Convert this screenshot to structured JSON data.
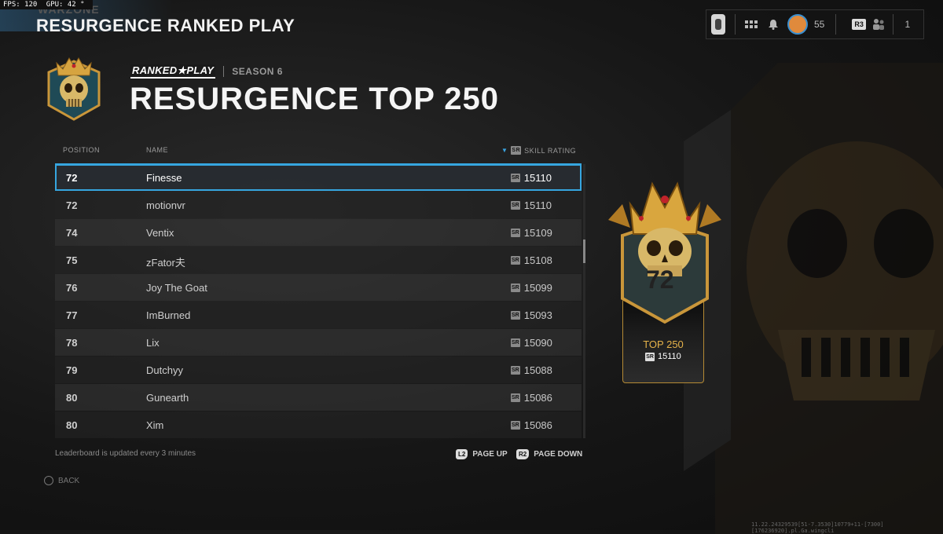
{
  "perf": {
    "fps": "FPS: 120",
    "gpu": "GPU: 42 °"
  },
  "app": {
    "logo": "WARZONE",
    "title": "RESURGENCE RANKED PLAY"
  },
  "topbar": {
    "level": "55",
    "r3_label": "R3",
    "party_count": "1"
  },
  "header": {
    "brand": "RANKED★PLAY",
    "season": "SEASON 6",
    "heading": "RESURGENCE TOP 250"
  },
  "table": {
    "columns": {
      "position": "POSITION",
      "name": "NAME",
      "sr_tag": "SR",
      "skill_rating": "SKILL RATING"
    },
    "rows": [
      {
        "position": "72",
        "name": "Finesse",
        "sr": "15110"
      },
      {
        "position": "72",
        "name": "motionvr",
        "sr": "15110"
      },
      {
        "position": "74",
        "name": "Ventix",
        "sr": "15109"
      },
      {
        "position": "75",
        "name": "zFator夫",
        "sr": "15108"
      },
      {
        "position": "76",
        "name": "Joy The Goat",
        "sr": "15099"
      },
      {
        "position": "77",
        "name": "ImBurned",
        "sr": "15093"
      },
      {
        "position": "78",
        "name": "Lix",
        "sr": "15090"
      },
      {
        "position": "79",
        "name": "Dutchyy",
        "sr": "15088"
      },
      {
        "position": "80",
        "name": "Gunearth",
        "sr": "15086"
      },
      {
        "position": "80",
        "name": "Xim",
        "sr": "15086"
      }
    ],
    "selected_index": 0
  },
  "footer": {
    "note": "Leaderboard is updated every 3 minutes",
    "page_up_key": "L2",
    "page_up": "PAGE UP",
    "page_down_key": "R2",
    "page_down": "PAGE DOWN",
    "back": "BACK"
  },
  "rank_card": {
    "position": "72",
    "tier": "TOP 250",
    "sr_tag": "SR",
    "sr": "15110"
  },
  "debug_text": "11.22.24329539[51-7.3530]10779+11-[7300][176236920].pl.Ga.wingcli",
  "colors": {
    "accent": "#36a6e0",
    "gold": "#e5b24a"
  }
}
